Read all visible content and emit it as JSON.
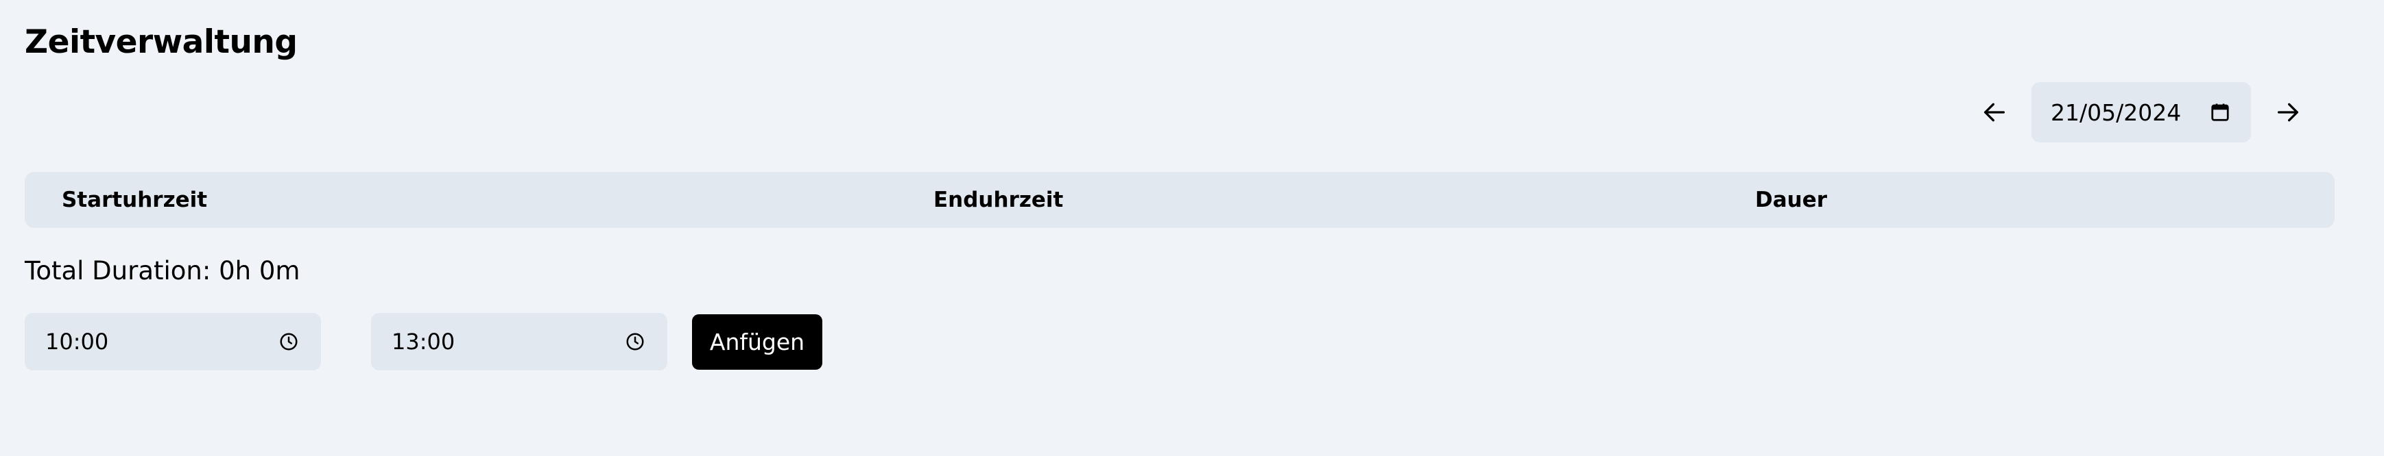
{
  "page": {
    "title": "Zeitverwaltung"
  },
  "date_nav": {
    "prev_icon": "arrow-left-icon",
    "next_icon": "arrow-right-icon",
    "date_value": "21/05/2024",
    "calendar_icon": "calendar-icon"
  },
  "table": {
    "columns": [
      "Startuhrzeit",
      "Enduhrzeit",
      "Dauer"
    ],
    "rows": []
  },
  "summary": {
    "total_duration": "Total Duration: 0h 0m"
  },
  "form": {
    "start_time": "10:00",
    "end_time": "13:00",
    "clock_icon": "clock-icon",
    "add_label": "Anfügen"
  },
  "colors": {
    "background": "#f0f3f8",
    "input_background": "#e2e8f0",
    "button_background": "#000000",
    "button_text": "#ffffff"
  }
}
